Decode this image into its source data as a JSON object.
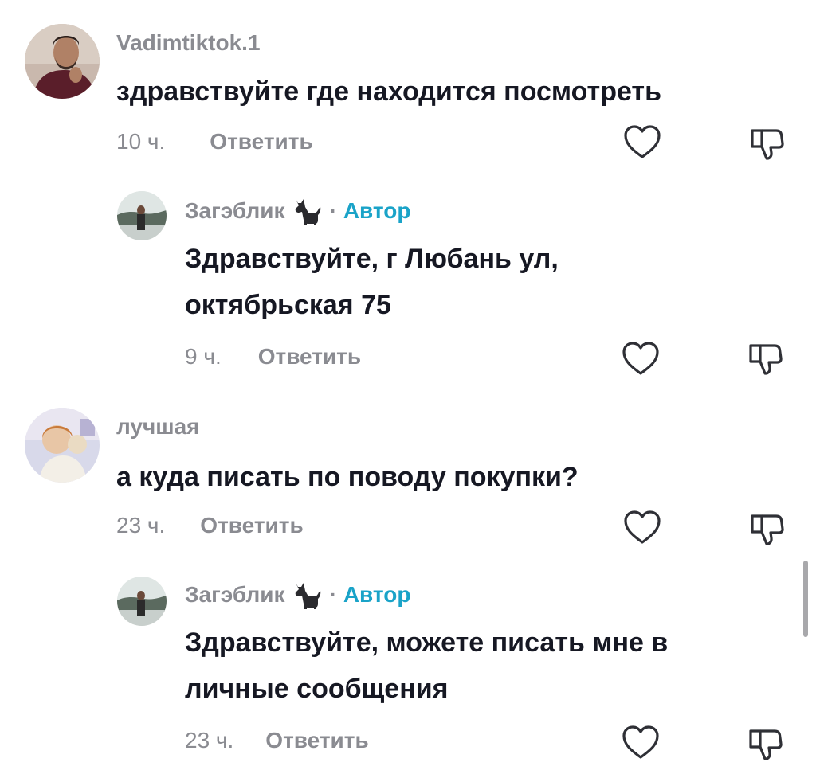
{
  "comments": [
    {
      "username": "Vadimtiktok.1",
      "text": "здравствуйте где находится посмотреть",
      "time": "10 ч.",
      "reply_label": "Ответить",
      "avatar_icon": "avatar-photo"
    },
    {
      "username": "Загэблик",
      "username_icon": "cat-icon",
      "author_dot": "·",
      "author_badge": "Автор",
      "text_lines": [
        "Здравствуйте, г Любань ул,",
        "октябрьская 75"
      ],
      "time": "9 ч.",
      "reply_label": "Ответить",
      "avatar_icon": "avatar-photo"
    },
    {
      "username": "лучшая",
      "text": "а куда писать по поводу покупки?",
      "time": "23 ч.",
      "reply_label": "Ответить",
      "avatar_icon": "avatar-photo"
    },
    {
      "username": "Загэблик",
      "username_icon": "cat-icon",
      "author_dot": "·",
      "author_badge": "Автор",
      "text_lines": [
        "Здравствуйте, можете писать мне в",
        "личные сообщения"
      ],
      "time": "23 ч.",
      "reply_label": "Ответить",
      "avatar_icon": "avatar-photo"
    }
  ],
  "actions": {
    "like_icon": "heart-outline-icon",
    "dislike_icon": "thumbs-down-outline-icon"
  },
  "colors": {
    "text": "#161823",
    "muted": "#8a8b91",
    "author_badge": "#1aa3c8",
    "scrollbar": "#a8a8ab"
  }
}
